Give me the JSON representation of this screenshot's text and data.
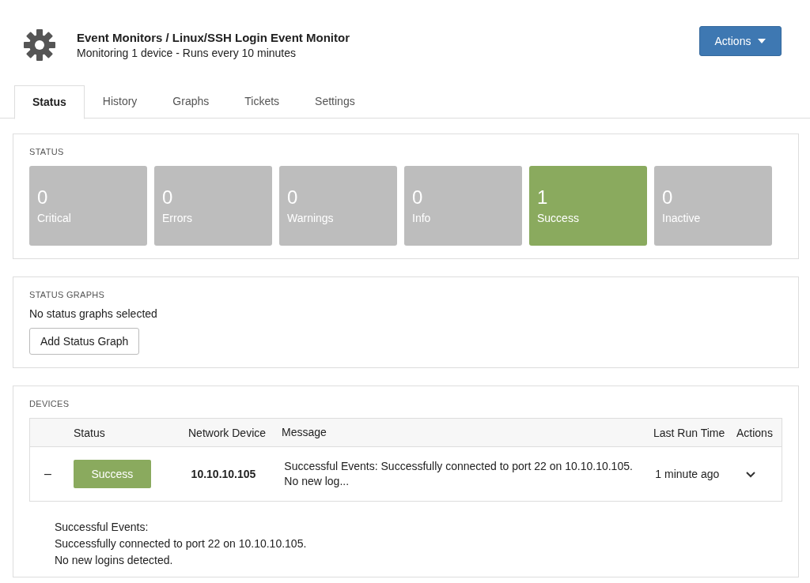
{
  "header": {
    "title": "Event Monitors / Linux/SSH Login Event Monitor",
    "subtitle": "Monitoring 1 device - Runs every 10 minutes",
    "actions_button": "Actions"
  },
  "tabs": [
    {
      "label": "Status",
      "selected": true
    },
    {
      "label": "History",
      "selected": false
    },
    {
      "label": "Graphs",
      "selected": false
    },
    {
      "label": "Tickets",
      "selected": false
    },
    {
      "label": "Settings",
      "selected": false
    }
  ],
  "status": {
    "heading": "STATUS",
    "tiles": [
      {
        "count": "0",
        "label": "Critical",
        "color": "#bdbdbd"
      },
      {
        "count": "0",
        "label": "Errors",
        "color": "#bdbdbd"
      },
      {
        "count": "0",
        "label": "Warnings",
        "color": "#bdbdbd"
      },
      {
        "count": "0",
        "label": "Info",
        "color": "#bdbdbd"
      },
      {
        "count": "1",
        "label": "Success",
        "color": "#8aaa5e"
      },
      {
        "count": "0",
        "label": "Inactive",
        "color": "#bdbdbd"
      }
    ]
  },
  "status_graphs": {
    "heading": "STATUS GRAPHS",
    "message": "No status graphs selected",
    "button": "Add Status Graph"
  },
  "devices": {
    "heading": "DEVICES",
    "columns": [
      "Status",
      "Network Device",
      "Message",
      "Last Run Time",
      "Actions"
    ],
    "rows": [
      {
        "toggle": "–",
        "expanded": true,
        "status": "Success",
        "color": "#8aaa5e",
        "device": "10.10.10.105",
        "message": "Successful Events: Successfully connected to port 22 on 10.10.10.105. No new log...",
        "last_run": "1 minute ago",
        "details": [
          "Successful Events:",
          "Successfully connected to port 22 on 10.10.10.105.",
          "No new logins detected."
        ]
      }
    ]
  }
}
